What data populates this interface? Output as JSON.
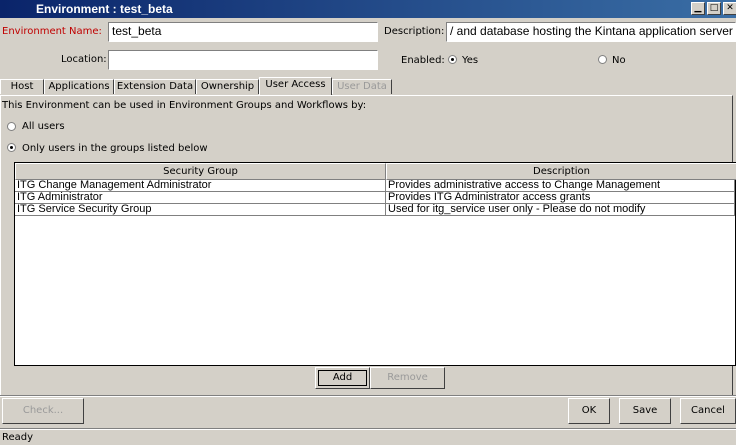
{
  "window": {
    "title": "Environment : test_beta",
    "controls": [
      "minimize-icon",
      "maximize-icon",
      "close-icon"
    ]
  },
  "form": {
    "env_name_label": "Environment Name:",
    "env_name_value": "test_beta",
    "description_label": "Description:",
    "description_value": "/ and database hosting the Kintana application server",
    "location_label": "Location:",
    "location_value": "",
    "enabled_label": "Enabled:",
    "enabled_yes": "Yes",
    "enabled_no": "No",
    "enabled_selected": "Yes"
  },
  "tabs": [
    {
      "label": "Host"
    },
    {
      "label": "Applications"
    },
    {
      "label": "Extension Data"
    },
    {
      "label": "Ownership"
    },
    {
      "label": "User Access"
    },
    {
      "label": "User Data"
    }
  ],
  "active_tab": "User Access",
  "user_access": {
    "intro": "This Environment can be used in Environment Groups and Workflows by:",
    "option_all": "All users",
    "option_groups": "Only users in the groups listed below",
    "selected_option": "Only users in the groups listed below",
    "table": {
      "columns": [
        "Security Group",
        "Description"
      ],
      "rows": [
        [
          "ITG Change Management Administrator",
          "Provides administrative access to Change Management"
        ],
        [
          "ITG Administrator",
          "Provides ITG Administrator access grants"
        ],
        [
          "ITG Service Security Group",
          "Used for itg_service user only - Please do not modify"
        ]
      ]
    },
    "add_label": "Add",
    "remove_label": "Remove"
  },
  "footer": {
    "check_label": "Check...",
    "ok_label": "OK",
    "save_label": "Save",
    "cancel_label": "Cancel"
  },
  "status": "Ready",
  "colors": {
    "title_start": "#0a246a",
    "title_end": "#3a6ea5",
    "required_label": "#c00000",
    "face": "#d4d0c8"
  }
}
